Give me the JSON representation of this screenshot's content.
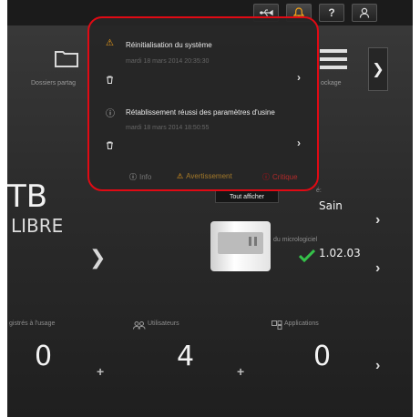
{
  "colors": {
    "accent_red": "#e00a14",
    "warning": "#f4a21a",
    "success": "#35c24a",
    "text": "#eeeeee"
  },
  "topbar": {
    "usb_icon": "usb-icon",
    "bell_icon": "bell-icon",
    "help_label": "?",
    "user_icon": "user-icon"
  },
  "tiles": {
    "shared_folders_label": "Dossiers partag",
    "stockage_label": "ockage",
    "capacity_value": "TB",
    "capacity_status": "LIBRE",
    "health_label": "é:",
    "health_value": "Sain",
    "firmware_label": "du micrologiciel",
    "firmware_value": "1.02.03",
    "storage_label": "gistrés à l'usage",
    "storage_count": "0",
    "users_label": "Utilisateurs",
    "users_count": "4",
    "apps_label": "Applications",
    "apps_count": "0",
    "tout_afficher": "Tout afficher"
  },
  "notifications": [
    {
      "icon": "warning-icon",
      "title": "Réinitialisation du système",
      "date": "mardi 18 mars 2014 20:35:30"
    },
    {
      "icon": "info-icon",
      "title": "Rétablissement réussi des paramètres d'usine",
      "date": "mardi 18 mars 2014 18:50:55"
    }
  ],
  "filters": {
    "info": "Info",
    "warning": "Avertissement",
    "critical": "Critique"
  }
}
